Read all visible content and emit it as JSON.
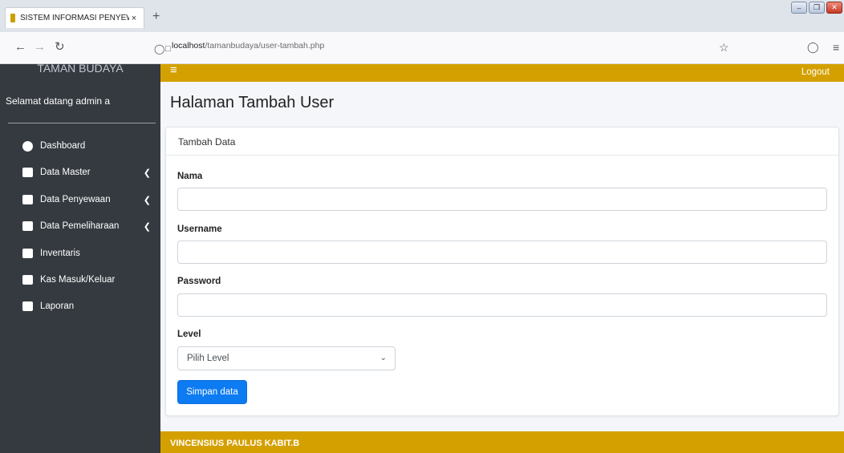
{
  "browser": {
    "tab_title": "SISTEM INFORMASI PENYEWAA",
    "tab_close": "×",
    "new_tab": "+",
    "url_host": "localhost",
    "url_path": "/tamanbudaya/user-tambah.php"
  },
  "sidebar": {
    "brand": "TAMAN BUDAYA",
    "welcome": "Selamat datang admin a",
    "items": [
      {
        "label": "Dashboard",
        "icon": "dashboard-icon",
        "chevron": false
      },
      {
        "label": "Data Master",
        "icon": "square-icon",
        "chevron": true
      },
      {
        "label": "Data Penyewaan",
        "icon": "square-icon",
        "chevron": true
      },
      {
        "label": "Data Pemeliharaan",
        "icon": "square-icon",
        "chevron": true
      },
      {
        "label": "Inventaris",
        "icon": "square-icon",
        "chevron": false
      },
      {
        "label": "Kas Masuk/Keluar",
        "icon": "square-icon",
        "chevron": false
      },
      {
        "label": "Laporan",
        "icon": "square-icon",
        "chevron": false
      }
    ]
  },
  "header": {
    "logout": "Logout"
  },
  "main": {
    "page_title": "Halaman Tambah User",
    "card_title": "Tambah Data",
    "fields": {
      "nama_label": "Nama",
      "username_label": "Username",
      "password_label": "Password",
      "level_label": "Level",
      "level_selected": "Pilih Level"
    },
    "submit": "Simpan data"
  },
  "footer": {
    "text": "VINCENSIUS PAULUS KABIT.B"
  },
  "colors": {
    "accent": "#d4a000",
    "sidebar": "#343a40",
    "primary_button": "#0d7bf2"
  }
}
